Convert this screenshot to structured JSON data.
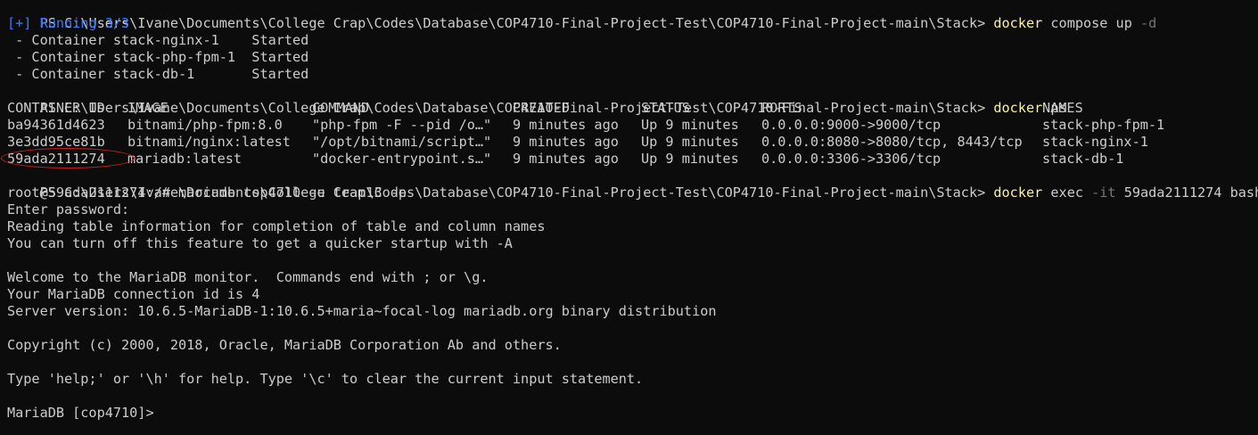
{
  "prompt": "PS C:\\Users\\Ivane\\Documents\\College Crap\\Codes\\Database\\COP4710-Final-Project-Test\\COP4710-Final-Project-main\\Stack> ",
  "cmd1": {
    "exe": "docker",
    "args": " compose up ",
    "flag": "-d"
  },
  "running": "[+] Running 3/3",
  "containers": [
    " - Container stack-nginx-1    Started",
    " - Container stack-php-fpm-1  Started",
    " - Container stack-db-1       Started"
  ],
  "cmd2": {
    "exe": "docker",
    "args": " ps"
  },
  "ps_header": [
    "CONTAINER ID",
    "IMAGE",
    "COMMAND",
    "CREATED",
    "STATUS",
    "PORTS",
    "NAMES"
  ],
  "ps_rows": [
    [
      "ba94361d4623",
      "bitnami/php-fpm:8.0",
      "\"php-fpm -F --pid /o…\"",
      "9 minutes ago",
      "Up 9 minutes",
      "0.0.0.0:9000->9000/tcp",
      "stack-php-fpm-1"
    ],
    [
      "3e3dd95ce81b",
      "bitnami/nginx:latest",
      "\"/opt/bitnami/script…\"",
      "9 minutes ago",
      "Up 9 minutes",
      "0.0.0.0:8080->8080/tcp, 8443/tcp",
      "stack-nginx-1"
    ],
    [
      "59ada2111274",
      "mariadb:latest",
      "\"docker-entrypoint.s…\"",
      "9 minutes ago",
      "Up 9 minutes",
      "0.0.0.0:3306->3306/tcp",
      "stack-db-1"
    ]
  ],
  "cmd3": {
    "exe": "docker",
    "args1": " exec ",
    "flag": "-it",
    "args2": " 59ada2111274 bash"
  },
  "output": [
    "root@59ada2111274:/# mariadb cop4710 -u team13 -p",
    "Enter password:",
    "Reading table information for completion of table and column names",
    "You can turn off this feature to get a quicker startup with -A",
    "",
    "Welcome to the MariaDB monitor.  Commands end with ; or \\g.",
    "Your MariaDB connection id is 4",
    "Server version: 10.6.5-MariaDB-1:10.6.5+maria~focal-log mariadb.org binary distribution",
    "",
    "Copyright (c) 2000, 2018, Oracle, MariaDB Corporation Ab and others.",
    "",
    "Type 'help;' or '\\h' for help. Type '\\c' to clear the current input statement.",
    "",
    "MariaDB [cop4710]> "
  ],
  "colors": {
    "background": "#0c0c0c",
    "text": "#cccccc",
    "command": "#f9f1a5",
    "flag": "#767676",
    "running": "#3b78ff",
    "annotation": "#d42020"
  }
}
